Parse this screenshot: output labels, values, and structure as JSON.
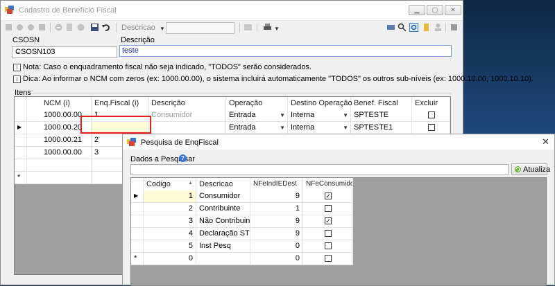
{
  "main_window": {
    "title": "Cadastro de Benefício Fiscal",
    "toolbar": {
      "search_label": "Descricao",
      "search_value": ""
    },
    "csosn": {
      "label": "CSOSN",
      "value": "CSOSN103"
    },
    "descricao": {
      "label": "Descrição",
      "value": "teste"
    },
    "notes": [
      "Nota: Caso o enquadramento fiscal não seja indicado, \"TODOS\" serão considerados.",
      "Dica: Ao informar o NCM com zeros (ex: 1000.00.00), o sistema incluirá automaticamente \"TODOS\" os outros sub-níveis (ex: 1000.10.00, 1000.10.10)."
    ],
    "itens_label": "Itens",
    "grid": {
      "columns": [
        "NCM (i)",
        "Enq.Fiscal (i)",
        "Descrição",
        "Operação",
        "Destino Operação",
        "Benef. Fiscal",
        "Excluir"
      ],
      "rows": [
        {
          "ncm": "1000.00.00",
          "enq": "1",
          "descricao": "Consumidor",
          "operacao": "Entrada",
          "destino": "Interna",
          "benef": "SPTESTE",
          "excluir": false
        },
        {
          "ncm": "1000.00.20",
          "enq": "",
          "descricao": "",
          "operacao": "Entrada",
          "destino": "Interna",
          "benef": "SPTESTE1",
          "excluir": false
        },
        {
          "ncm": "1000.00.21",
          "enq": "2",
          "descricao": "",
          "operacao": "",
          "destino": "",
          "benef": "",
          "excluir": false
        },
        {
          "ncm": "1000.00.00",
          "enq": "3",
          "descricao": "",
          "operacao": "",
          "destino": "",
          "benef": "",
          "excluir": false
        }
      ],
      "new_row_marker": "*",
      "current_row_marker": "▶"
    }
  },
  "dialog": {
    "title": "Pesquisa de EnqFiscal",
    "search_label": "Dados a Pesquisar",
    "search_value": "",
    "refresh_button": "Atualiza",
    "grid": {
      "columns": [
        "Codigo",
        "Descricao",
        "NFeIndIEDest",
        "NFeConsumidorFinal"
      ],
      "rows": [
        {
          "codigo": "1",
          "descricao": "Consumidor",
          "ind": "9",
          "final": true
        },
        {
          "codigo": "2",
          "descricao": "Contribuinte",
          "ind": "1",
          "final": false
        },
        {
          "codigo": "3",
          "descricao": "Não Contribuinte",
          "ind": "9",
          "final": true
        },
        {
          "codigo": "4",
          "descricao": "Declaração ST",
          "ind": "9",
          "final": false
        },
        {
          "codigo": "5",
          "descricao": "Inst Pesq",
          "ind": "0",
          "final": false
        },
        {
          "codigo": "0",
          "descricao": "",
          "ind": "0",
          "final": false
        }
      ],
      "sort_indicator": "▲",
      "new_row_marker": "*",
      "current_row_marker": "▶"
    }
  },
  "colors": {
    "annotation": "#e0211c",
    "selection": "#fffbd6"
  }
}
